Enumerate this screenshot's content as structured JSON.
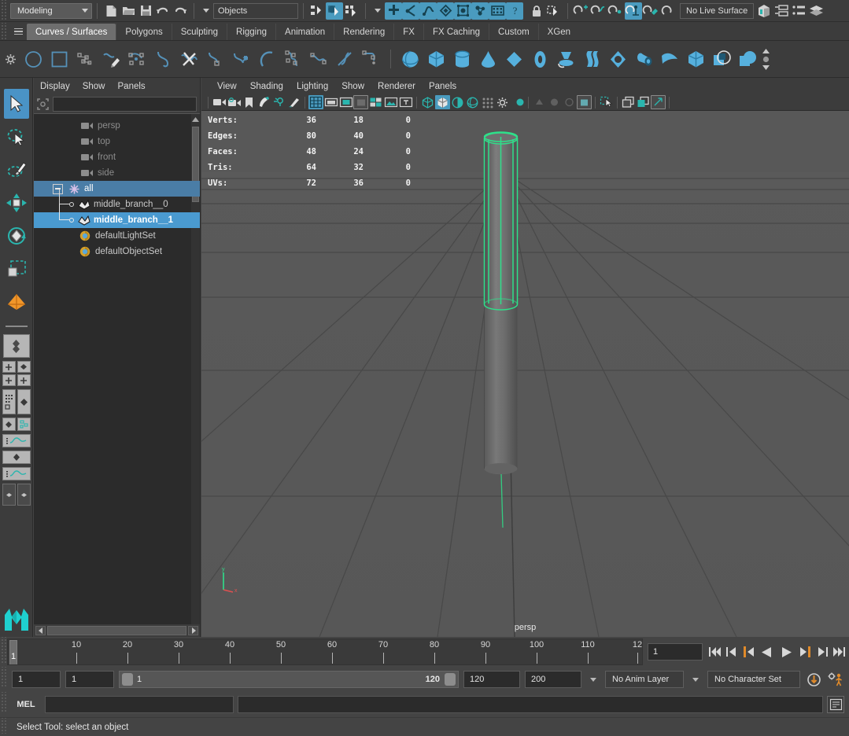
{
  "topbar": {
    "menu_set": "Modeling",
    "object_field": "Objects",
    "live_surface": "No Live Surface",
    "icons": [
      "new-scene-icon",
      "open-scene-icon",
      "save-scene-icon",
      "undo-icon",
      "redo-icon",
      "select-by-hierarchy-icon",
      "select-by-object-icon",
      "select-by-component-icon",
      "snap-to-grid-icon",
      "snap-to-curve-icon",
      "snap-to-point-icon",
      "snap-to-projected-center-icon",
      "snap-to-view-plane-icon",
      "make-live-icon",
      "render-view-icon",
      "help-icon",
      "lock-icon",
      "selection-mask-icon",
      "construction-history-icon",
      "render-current-frame-icon",
      "ipr-render-icon",
      "render-settings-icon",
      "hypershade-icon",
      "render-sequence-icon",
      "no-live-surface-icon",
      "attribute-editor-icon",
      "tool-settings-icon",
      "channel-box-icon"
    ]
  },
  "shelf_tabs": {
    "active": "Curves / Surfaces",
    "items": [
      "Curves / Surfaces",
      "Polygons",
      "Sculpting",
      "Rigging",
      "Animation",
      "Rendering",
      "FX",
      "FX Caching",
      "Custom",
      "XGen"
    ]
  },
  "shelf_icons": [
    "circle-icon",
    "square-icon",
    "cv-curve-icon",
    "pencil-curve-icon",
    "ep-curve-icon",
    "bezier-curve-icon",
    "cut-curve-icon",
    "attach-curve-icon",
    "extend-curve-icon",
    "arc-curve-icon",
    "rebuild-curve-icon",
    "offset-curve-icon",
    "curve-fillet-icon",
    "curve-tangent-icon",
    "nurbs-sphere-icon",
    "nurbs-cube-icon",
    "nurbs-cylinder-icon",
    "nurbs-cone-icon",
    "nurbs-plane-icon",
    "nurbs-torus-icon",
    "revolve-icon",
    "loft-icon",
    "planar-icon",
    "extrude-icon",
    "birail-icon",
    "boundary-icon",
    "square-surface-icon",
    "bevel-plus-icon"
  ],
  "toolbox": [
    {
      "name": "select-tool",
      "selected": true
    },
    {
      "name": "lasso-select-tool",
      "selected": false
    },
    {
      "name": "paint-select-tool",
      "selected": false
    },
    {
      "name": "move-tool",
      "selected": false
    },
    {
      "name": "rotate-tool",
      "selected": false
    },
    {
      "name": "scale-tool",
      "selected": false
    },
    {
      "name": "last-tool-used",
      "selected": false
    }
  ],
  "outliner": {
    "menus": [
      "Display",
      "Show",
      "Panels"
    ],
    "search_value": "",
    "search_placeholder": "",
    "items": [
      {
        "label": "persp",
        "icon": "camera-icon",
        "indent": 1,
        "state": "dim"
      },
      {
        "label": "top",
        "icon": "camera-icon",
        "indent": 1,
        "state": "dim"
      },
      {
        "label": "front",
        "icon": "camera-icon",
        "indent": 1,
        "state": "dim"
      },
      {
        "label": "side",
        "icon": "camera-icon",
        "indent": 1,
        "state": "dim"
      },
      {
        "label": "all",
        "icon": "group-icon",
        "indent": 0,
        "state": "selected-parent",
        "expander": "minus"
      },
      {
        "label": "middle_branch__0",
        "icon": "mesh-icon",
        "indent": 2,
        "state": "child"
      },
      {
        "label": "middle_branch__1",
        "icon": "mesh-icon",
        "indent": 2,
        "state": "selected"
      },
      {
        "label": "defaultLightSet",
        "icon": "set-icon",
        "indent": 3,
        "state": "normal"
      },
      {
        "label": "defaultObjectSet",
        "icon": "set-icon",
        "indent": 3,
        "state": "normal"
      }
    ]
  },
  "viewport": {
    "menus": [
      "View",
      "Shading",
      "Lighting",
      "Show",
      "Renderer",
      "Panels"
    ],
    "camera_label": "persp",
    "axis_labels": {
      "y": "y",
      "x": "x"
    },
    "hud": {
      "columns": 3,
      "rows": [
        {
          "label": "Verts:",
          "values": [
            "36",
            "18",
            "0"
          ]
        },
        {
          "label": "Edges:",
          "values": [
            "80",
            "40",
            "0"
          ]
        },
        {
          "label": "Faces:",
          "values": [
            "48",
            "24",
            "0"
          ]
        },
        {
          "label": "Tris:",
          "values": [
            "64",
            "32",
            "0"
          ]
        },
        {
          "label": "UVs:",
          "values": [
            "72",
            "36",
            "0"
          ]
        }
      ]
    },
    "colors": {
      "background_top": "#5b5b5b",
      "background_bottom": "#4e4e4e",
      "grid_line": "#4a4a4a",
      "selection_green": "#2ee08a",
      "mesh_gray": "#6a6a6a"
    }
  },
  "timeline": {
    "ticks": [
      "10",
      "20",
      "30",
      "40",
      "50",
      "60",
      "70",
      "80",
      "90",
      "100",
      "110",
      "12"
    ],
    "current_marker": "1",
    "current_frame_field": "1"
  },
  "playback_icons": [
    "go-to-start-icon",
    "step-back-key-icon",
    "step-back-frame-icon",
    "play-backwards-icon",
    "play-forwards-icon",
    "step-forward-frame-icon",
    "step-forward-key-icon",
    "go-to-end-icon"
  ],
  "range": {
    "anim_start": "1",
    "range_start": "1",
    "slider_min": "1",
    "slider_max": "120",
    "range_end": "120",
    "anim_end": "200",
    "anim_layer": "No Anim Layer",
    "character_set": "No Character Set",
    "auto_key_icon": "auto-keyframe-icon",
    "anim_prefs_icon": "animation-preferences-icon"
  },
  "mel": {
    "label": "MEL",
    "input_value": "",
    "output_value": "",
    "script_editor_icon": "script-editor-icon"
  },
  "status": {
    "text": "Select Tool: select an object"
  },
  "accent": {
    "blue": "#4a9bbf",
    "select_blue": "#4a93c6",
    "shelf_icon_blue": "#56b0dd",
    "curve_blue": "#5591b8",
    "orange": "#e08a2a",
    "teal": "#2ab5ae"
  }
}
